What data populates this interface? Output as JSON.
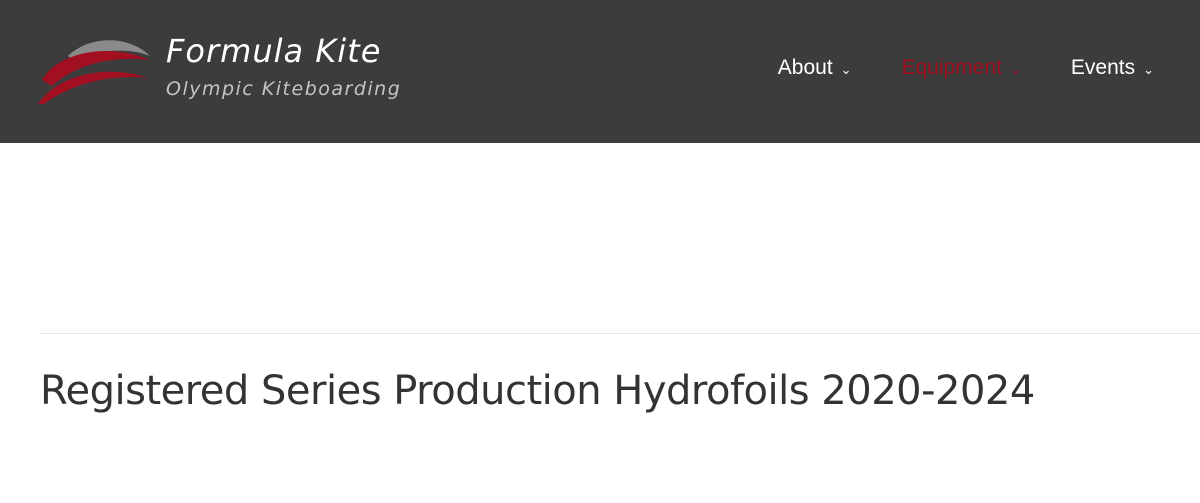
{
  "header": {
    "logo": {
      "title_bold": "Formula",
      "title_rest": "Kite",
      "subtitle": "Olympic Kiteboarding"
    },
    "nav": [
      {
        "label": "About",
        "active": false
      },
      {
        "label": "Equipment",
        "active": true
      },
      {
        "label": "Events",
        "active": false
      }
    ]
  },
  "main": {
    "title": "Registered Series Production Hydrofoils 2020-2024"
  },
  "colors": {
    "header_bg": "#3c3c3c",
    "accent": "#a10f21",
    "logo_grey": "#8a8a8a"
  }
}
